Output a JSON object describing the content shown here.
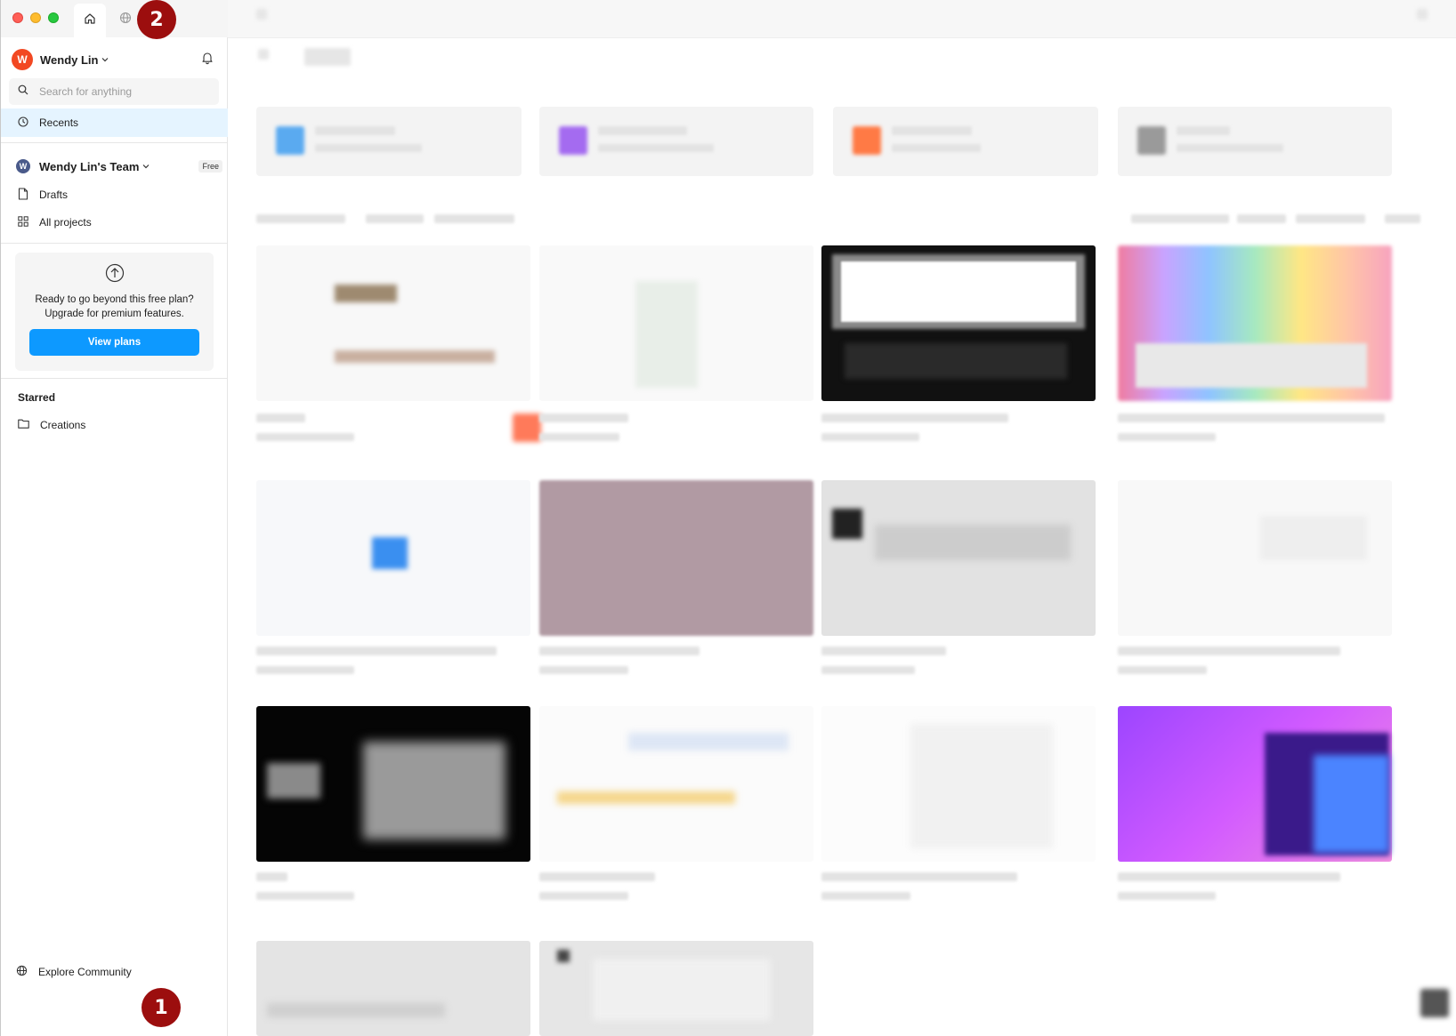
{
  "window": {
    "tabs": [
      "home-icon",
      "globe-icon"
    ]
  },
  "sidebar": {
    "user": {
      "initial": "W",
      "name": "Wendy Lin"
    },
    "search": {
      "placeholder": "Search for anything"
    },
    "recents_label": "Recents",
    "team": {
      "initial": "W",
      "name": "Wendy Lin's Team",
      "plan_badge": "Free"
    },
    "drafts_label": "Drafts",
    "all_projects_label": "All projects",
    "upgrade": {
      "line1": "Ready to go beyond this free plan?",
      "line2": "Upgrade for premium features.",
      "button_label": "View plans"
    },
    "starred_title": "Starred",
    "starred_items": [
      "Creations"
    ],
    "explore_label": "Explore Community"
  },
  "annotations": {
    "marker1": "1",
    "marker2": "2"
  },
  "colors": {
    "accent": "#0d99ff",
    "selected_bg": "#e5f4ff",
    "avatar": "#f24822",
    "marker": "#9c0e0e"
  }
}
